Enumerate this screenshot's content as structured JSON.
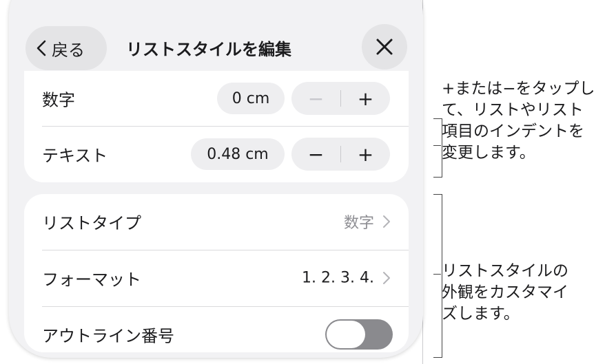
{
  "header": {
    "back_label": "戻る",
    "title": "リストスタイルを編集"
  },
  "indent": {
    "rows": [
      {
        "label": "数字",
        "value": "0 cm",
        "minus": "−",
        "plus": "+"
      },
      {
        "label": "テキスト",
        "value": "0.48 cm",
        "minus": "−",
        "plus": "+"
      }
    ]
  },
  "list_settings": {
    "list_type": {
      "label": "リストタイプ",
      "value": "数字"
    },
    "format": {
      "label": "フォーマット",
      "value": "1. 2. 3. 4."
    },
    "outline": {
      "label": "アウトライン番号",
      "on": false
    }
  },
  "callouts": {
    "indent_lines": [
      "+または−をタップし",
      "て、リストやリスト",
      "項目のインデントを",
      "変更します。"
    ],
    "style_lines": [
      "リストスタイルの",
      "外観をカスタマイ",
      "ズします。"
    ]
  },
  "colors": {
    "panel_bg": "#f2f2f4",
    "card_bg": "#ffffff",
    "button_bg": "#e4e4e6",
    "secondary_text": "#8e8e93",
    "disabled": "#c7c7cc",
    "toggle_off": "#8a8a8e"
  },
  "icons": {
    "back": "chevron-left-icon",
    "close": "close-icon",
    "disclosure": "chevron-right-icon"
  }
}
